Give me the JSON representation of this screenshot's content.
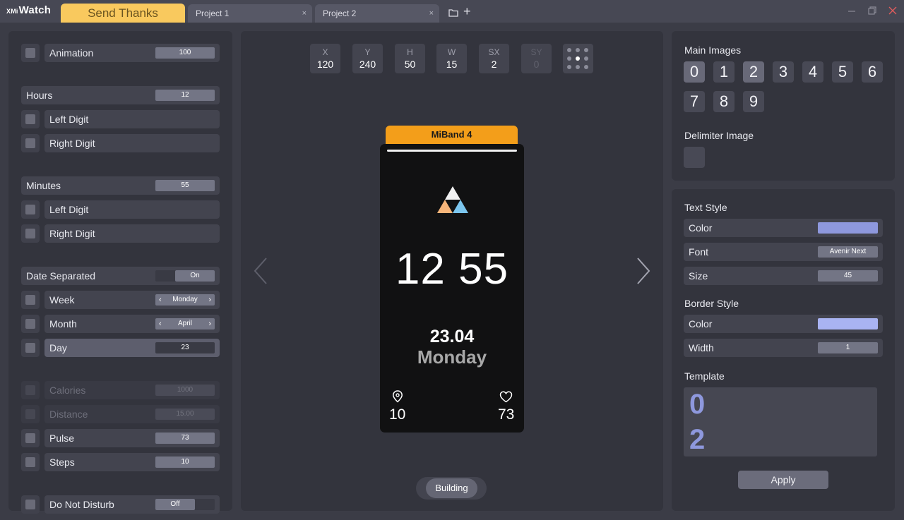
{
  "app": {
    "logo_prefix": "XMi",
    "logo_name": "Watch"
  },
  "titlebar": {
    "send_thanks": "Send Thanks",
    "tabs": [
      {
        "label": "Project 1",
        "close": "×"
      },
      {
        "label": "Project 2",
        "close": "×"
      }
    ],
    "add_tab": "+"
  },
  "left": {
    "animation": {
      "label": "Animation",
      "value": "100"
    },
    "hours": {
      "label": "Hours",
      "value": "12",
      "left_digit": "Left Digit",
      "right_digit": "Right Digit"
    },
    "minutes": {
      "label": "Minutes",
      "value": "55",
      "left_digit": "Left Digit",
      "right_digit": "Right Digit"
    },
    "date_separated": {
      "label": "Date Separated",
      "value": "On"
    },
    "week": {
      "label": "Week",
      "value": "Monday",
      "prev": "‹",
      "next": "›"
    },
    "month": {
      "label": "Month",
      "value": "April",
      "prev": "‹",
      "next": "›"
    },
    "day": {
      "label": "Day",
      "value": "23"
    },
    "calories": {
      "label": "Calories",
      "value": "1000"
    },
    "distance": {
      "label": "Distance",
      "value": "15.00"
    },
    "pulse": {
      "label": "Pulse",
      "value": "73"
    },
    "steps": {
      "label": "Steps",
      "value": "10"
    },
    "dnd": {
      "label": "Do Not Disturb",
      "value": "Off"
    }
  },
  "coords": [
    {
      "key": "X",
      "value": "120"
    },
    {
      "key": "Y",
      "value": "240"
    },
    {
      "key": "H",
      "value": "50"
    },
    {
      "key": "W",
      "value": "15"
    },
    {
      "key": "SX",
      "value": "2"
    },
    {
      "key": "SY",
      "value": "0"
    }
  ],
  "device": {
    "name": "MiBand 4",
    "time": "12 55",
    "date": "23.04",
    "weekday": "Monday",
    "steps": "10",
    "pulse": "73"
  },
  "status": {
    "building": "Building"
  },
  "right": {
    "main_images": "Main Images",
    "digits": [
      "0",
      "1",
      "2",
      "3",
      "4",
      "5",
      "6",
      "7",
      "8",
      "9"
    ],
    "delimiter_image": "Delimiter Image",
    "text_style": "Text Style",
    "text_color_label": "Color",
    "text_color": "#8e98dd",
    "font_label": "Font",
    "font_value": "Avenir Next",
    "size_label": "Size",
    "size_value": "45",
    "border_style": "Border Style",
    "border_color_label": "Color",
    "border_color": "#a9b3f2",
    "width_label": "Width",
    "width_value": "1",
    "template": "Template",
    "template_digits": [
      "0",
      "2"
    ],
    "apply": "Apply"
  }
}
